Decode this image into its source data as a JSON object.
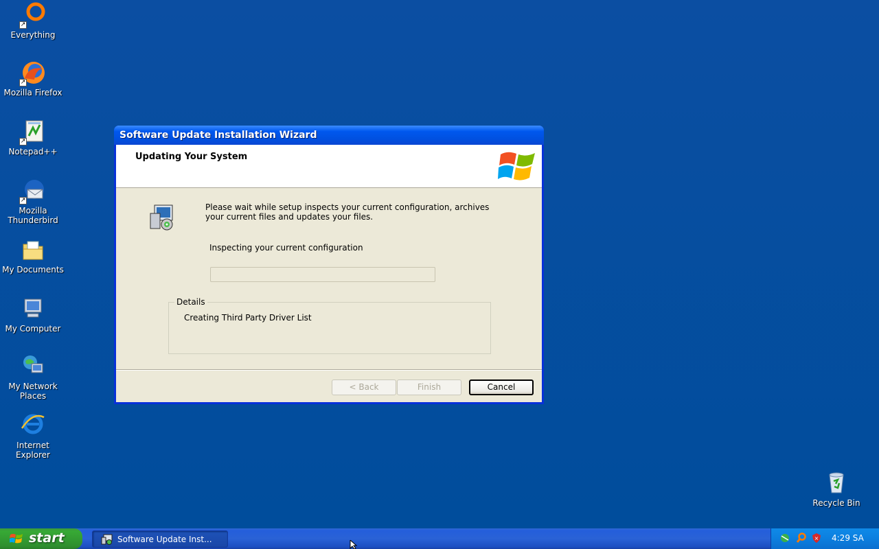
{
  "desktop": {
    "icons": [
      {
        "label": "Everything"
      },
      {
        "label": "Mozilla Firefox"
      },
      {
        "label": "Notepad++"
      },
      {
        "label": "Mozilla Thunderbird"
      },
      {
        "label": "My Documents"
      },
      {
        "label": "My Computer"
      },
      {
        "label": "My Network Places"
      },
      {
        "label": "Internet Explorer"
      },
      {
        "label": "Recycle Bin"
      }
    ]
  },
  "dialog": {
    "title": "Software Update Installation Wizard",
    "header_title": "Updating Your System",
    "description": "Please wait while setup inspects your current configuration, archives your current files and updates your files.",
    "status": "Inspecting your current configuration",
    "progress": 0,
    "details_label": "Details",
    "details_text": "Creating Third Party Driver List",
    "buttons": {
      "back": "< Back",
      "finish": "Finish",
      "cancel": "Cancel"
    }
  },
  "taskbar": {
    "start_label": "start",
    "task_label": "Software Update Inst...",
    "clock": "4:29 SA"
  },
  "colors": {
    "desktop": "#0a4fa0",
    "titlebar": "#0058ee",
    "dialog_bg": "#ece9d8",
    "start": "#37a935"
  }
}
